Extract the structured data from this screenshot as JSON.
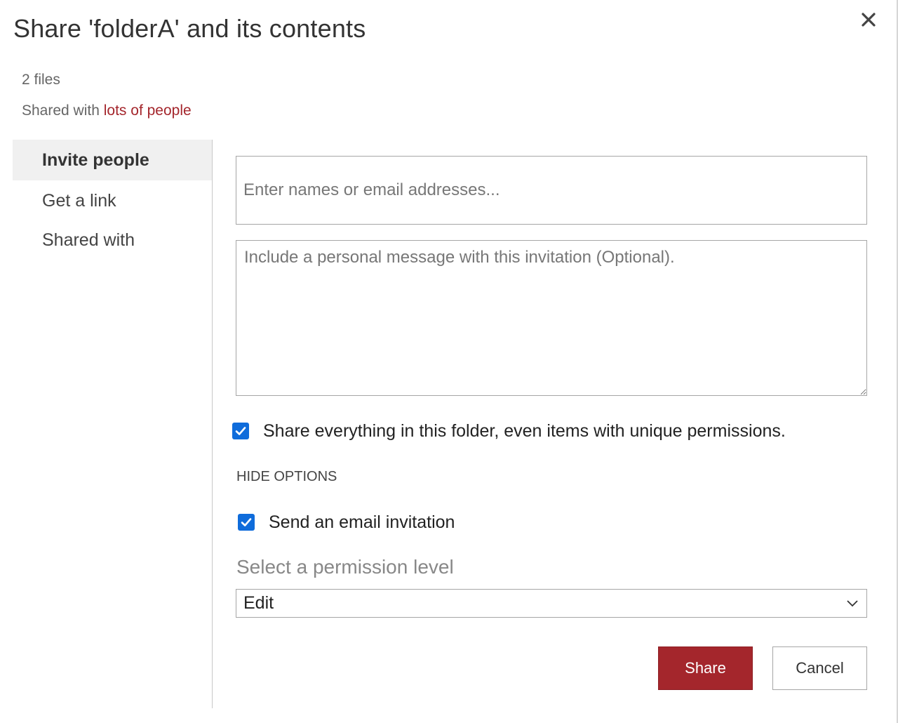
{
  "dialog": {
    "title": "Share 'folderA' and its contents",
    "files_count": "2 files",
    "shared_with_prefix": "Shared with",
    "shared_with_link": "lots of people"
  },
  "sidebar": {
    "items": [
      {
        "label": "Invite people",
        "active": true
      },
      {
        "label": "Get a link",
        "active": false
      },
      {
        "label": "Shared with",
        "active": false
      }
    ]
  },
  "form": {
    "people_placeholder": "Enter names or email addresses...",
    "message_placeholder": "Include a personal message with this invitation (Optional).",
    "share_everything_label": "Share everything in this folder, even items with unique permissions.",
    "share_everything_checked": true,
    "hide_options_label": "HIDE OPTIONS",
    "send_email_label": "Send an email invitation",
    "send_email_checked": true,
    "permission_label": "Select a permission level",
    "permission_value": "Edit"
  },
  "buttons": {
    "share_label": "Share",
    "cancel_label": "Cancel"
  },
  "colors": {
    "accent": "#a4262c",
    "checkbox": "#0f6cdb"
  },
  "icons": [
    "close-icon",
    "checkmark-icon",
    "chevron-down-icon"
  ]
}
